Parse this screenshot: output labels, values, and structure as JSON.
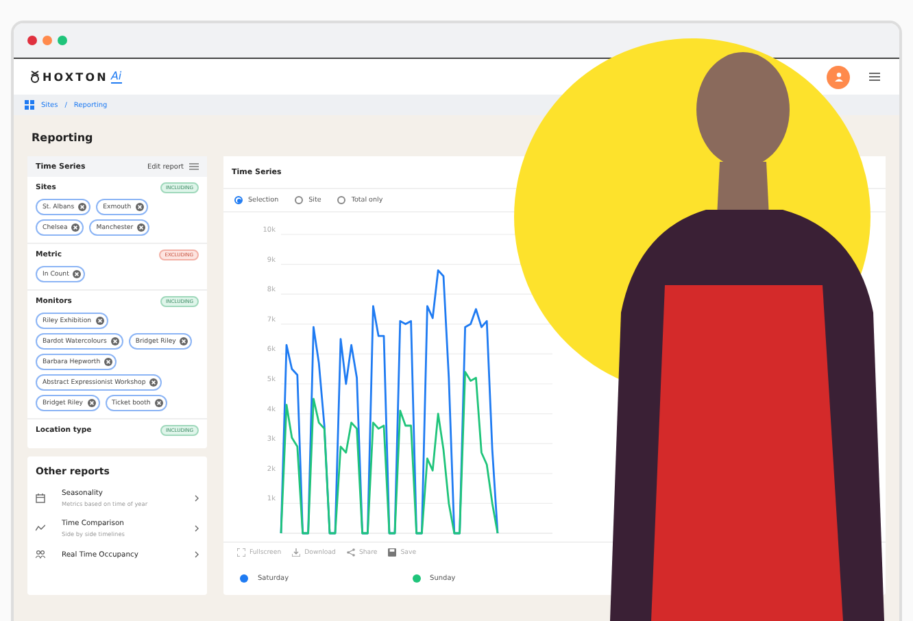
{
  "window": {
    "controls": [
      {
        "kind": "close"
      },
      {
        "kind": "minimize"
      },
      {
        "kind": "maximize"
      }
    ]
  },
  "header": {
    "logo": "HOXTON",
    "logo_suffix": "Ai"
  },
  "breadcrumb": [
    "Sites",
    "/",
    "Reporting"
  ],
  "page_title": "Reporting",
  "filter_panel": {
    "title": "Time Series",
    "edit_label": "Edit report",
    "sections": [
      {
        "title": "Sites",
        "badge": "INCLUDING",
        "kind": "including",
        "chips": [
          "St. Albans",
          "Exmouth",
          "Chelsea",
          "Manchester"
        ]
      },
      {
        "title": "Metric",
        "badge": "EXCLUDING",
        "kind": "excluding",
        "chips": [
          "In Count"
        ]
      },
      {
        "title": "Monitors",
        "badge": "INCLUDING",
        "kind": "including",
        "chips": [
          "Riley Exhibition",
          "Bardot Watercolours",
          "Bridget Riley",
          "Barbara Hepworth",
          "Abstract Expressionist Workshop",
          "Bridget Riley",
          "Ticket booth"
        ]
      },
      {
        "title": "Location type",
        "badge": "INCLUDING",
        "kind": "including"
      }
    ]
  },
  "other_reports": {
    "title": "Other reports",
    "items": [
      {
        "kind": "calendar",
        "title": "Seasonality",
        "subtitle": "Metrics based on time of year"
      },
      {
        "kind": "compare",
        "title": "Time Comparison",
        "subtitle": "Side by side timelines"
      },
      {
        "kind": "occupancy",
        "title": "Real Time Occupancy"
      }
    ]
  },
  "chart_panel": {
    "title": "Time Series",
    "options": [
      {
        "label": "Selection",
        "selected": true
      },
      {
        "label": "Site",
        "selected": false
      },
      {
        "label": "Total only",
        "selected": false
      }
    ],
    "chart_data": {
      "type": "line",
      "grid": true,
      "ylim": [
        0,
        10000
      ],
      "yticks": [
        {
          "value": 1000,
          "label": "1k"
        },
        {
          "value": 2000,
          "label": "2k"
        },
        {
          "value": 3000,
          "label": "3k"
        },
        {
          "value": 4000,
          "label": "4k"
        },
        {
          "value": 5000,
          "label": "5k"
        },
        {
          "value": 6000,
          "label": "6k"
        },
        {
          "value": 7000,
          "label": "7k"
        },
        {
          "value": 8000,
          "label": "8k"
        },
        {
          "value": 9000,
          "label": "9k"
        },
        {
          "value": 10000,
          "label": "10k"
        }
      ],
      "series": [
        {
          "name": "Saturday",
          "color": "#1f7bf2",
          "values": [
            0,
            6300,
            5500,
            5300,
            0,
            0,
            6900,
            5700,
            3600,
            0,
            0,
            6500,
            5000,
            6300,
            5200,
            0,
            0,
            7600,
            6600,
            6600,
            0,
            0,
            7100,
            7000,
            7100,
            0,
            0,
            7600,
            7200,
            8800,
            8600,
            5200,
            0,
            0,
            6900,
            7000,
            7500,
            6900,
            7100,
            2800,
            0
          ]
        },
        {
          "name": "Sunday",
          "color": "#1fc47a",
          "values": [
            0,
            4300,
            3200,
            2900,
            0,
            0,
            4500,
            3700,
            3500,
            0,
            0,
            2900,
            2700,
            3700,
            3500,
            0,
            0,
            3700,
            3500,
            3600,
            0,
            0,
            4100,
            3600,
            3600,
            0,
            0,
            2500,
            2100,
            4000,
            2800,
            1000,
            0,
            0,
            5400,
            5100,
            5200,
            2700,
            2300,
            1000,
            0
          ]
        }
      ]
    },
    "actions": [
      {
        "kind": "fullscreen",
        "label": "Fullscreen"
      },
      {
        "kind": "download",
        "label": "Download"
      },
      {
        "kind": "share",
        "label": "Share"
      },
      {
        "kind": "save",
        "label": "Save"
      }
    ]
  }
}
